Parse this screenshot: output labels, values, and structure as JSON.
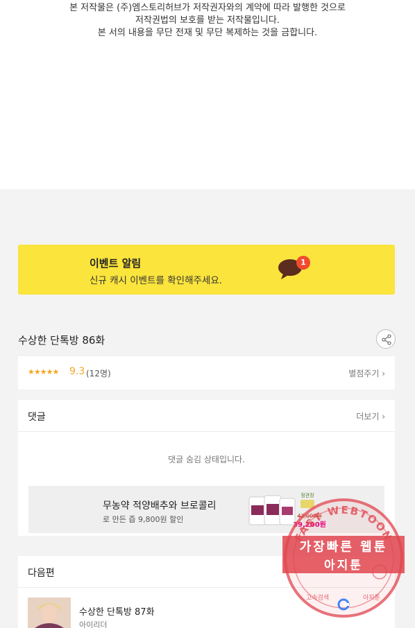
{
  "copyright": {
    "line1": "본 저작물은 (주)엠스토리허브가 저작권자와의 계약에 따라 발행한 것으로",
    "line2": "저작권법의 보호를 받는 저작물입니다.",
    "line3": "본 서의 내용을 무단 전재 및 무단 복제하는 것을 금합니다."
  },
  "event": {
    "title": "이벤트 알림",
    "subtitle": "신규 캐시 이벤트를 확인해주세요.",
    "badge": "1",
    "icon": "chat-bubble-icon",
    "bg_color": "#fbe43c",
    "badge_color": "#f24a30"
  },
  "episode": {
    "title": "수상한 단톡방 86화",
    "share_icon": "share-icon"
  },
  "rating": {
    "stars": "★★★★★",
    "score": "9.3",
    "count": "(12명)",
    "rate_label": "별점주기 ›",
    "star_color": "#f5a623"
  },
  "comments": {
    "label": "댓글",
    "more_label": "더보기 ›",
    "hidden_message": "댓글 숨김 상태입니다."
  },
  "ad": {
    "title": "무농약 적양배추와 브로콜리",
    "subtitle": "로 만든 즙 9,800원 할인",
    "brand": "정관장",
    "old_price": "42,000원",
    "new_price": "39,200원"
  },
  "next": {
    "label": "다음편",
    "episode_title": "수상한 단톡방 87화",
    "author": "아이리더"
  },
  "stamp": {
    "ring_text": "FAST WEBTOON",
    "main_line1": "가장빠른 웹툰",
    "main_line2": "아지툰",
    "bottom_left": "고속검색",
    "bottom_right": "아지툰",
    "color": "#e0464f"
  }
}
